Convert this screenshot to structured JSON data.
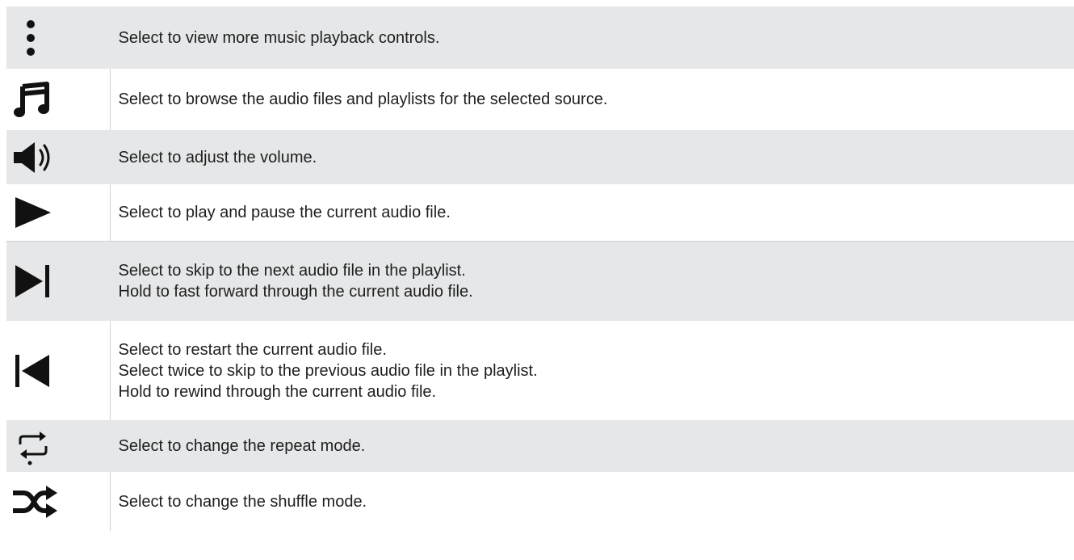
{
  "rows": [
    {
      "icon": "more-vertical-icon",
      "lines": [
        "Select to view more music playback controls."
      ]
    },
    {
      "icon": "music-note-icon",
      "lines": [
        "Select to browse the audio files and playlists for the selected source."
      ]
    },
    {
      "icon": "volume-icon",
      "lines": [
        "Select to adjust the volume."
      ]
    },
    {
      "icon": "play-icon",
      "lines": [
        "Select to play and pause the current audio file."
      ]
    },
    {
      "icon": "skip-next-icon",
      "lines": [
        "Select to skip to the next audio file in the playlist.",
        "Hold to fast forward through the current audio file."
      ]
    },
    {
      "icon": "skip-previous-icon",
      "lines": [
        "Select to restart the current audio file.",
        "Select twice to skip to the previous audio file in the playlist.",
        "Hold to rewind through the current audio file."
      ]
    },
    {
      "icon": "repeat-icon",
      "lines": [
        "Select to change the repeat mode."
      ]
    },
    {
      "icon": "shuffle-icon",
      "lines": [
        "Select to change the shuffle mode."
      ]
    }
  ],
  "colors": {
    "shaded_row": "#e6e7e8",
    "plain_row": "#ffffff",
    "icon": "#111111",
    "text": "#1e1e1e"
  }
}
